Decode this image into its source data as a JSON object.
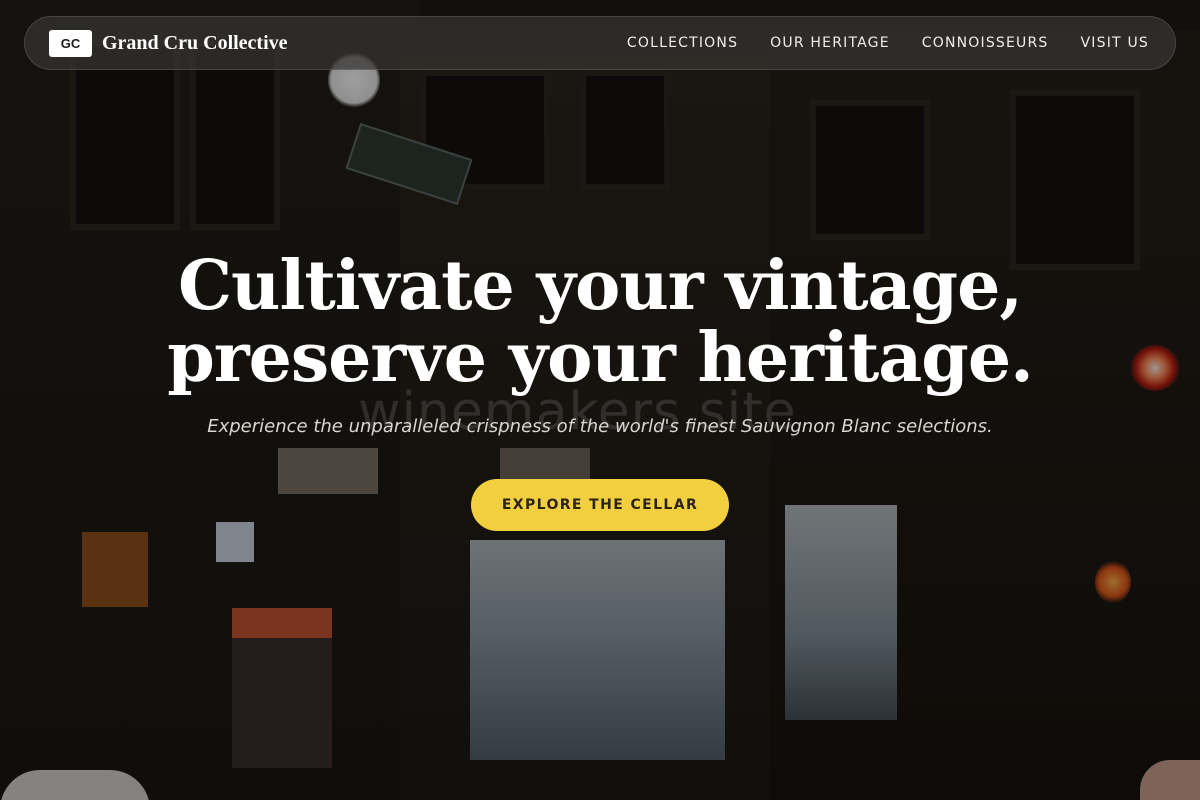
{
  "nav": {
    "logo_mark": "GC",
    "brand_name": "Grand Cru Collective",
    "links": [
      "COLLECTIONS",
      "OUR HERITAGE",
      "CONNOISSEURS",
      "VISIT US"
    ]
  },
  "hero": {
    "title_line1": "Cultivate your vintage,",
    "title_line2": "preserve your heritage.",
    "subtitle": "Experience the unparalleled crispness of the world's finest Sauvignon Blanc selections.",
    "cta_label": "EXPLORE THE CELLAR"
  },
  "background": {
    "watermark_text": "winemakers.site"
  },
  "colors": {
    "accent": "#f2cf3e",
    "nav_bg": "#373432",
    "overlay": "#000000"
  }
}
